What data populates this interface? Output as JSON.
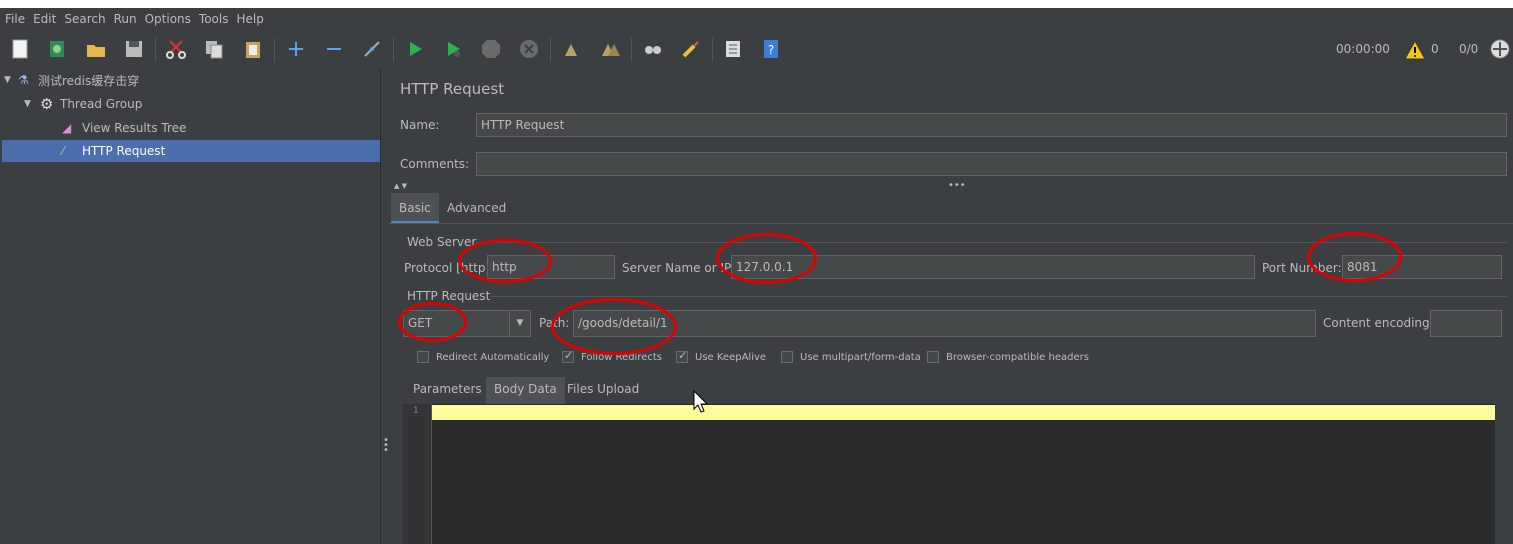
{
  "menu": [
    "File",
    "Edit",
    "Search",
    "Run",
    "Options",
    "Tools",
    "Help"
  ],
  "toolbar_icons": [
    "new-icon",
    "templates-icon",
    "open-icon",
    "save-icon",
    "cut-icon",
    "copy-icon",
    "paste-icon",
    "expand-icon",
    "collapse-icon",
    "toggle-icon",
    "start-icon",
    "start-no-pauses-icon",
    "stop-icon",
    "shutdown-icon",
    "clear-icon",
    "clear-all-icon",
    "search-icon",
    "reset-search-icon",
    "function-helper-icon",
    "help-icon"
  ],
  "status": {
    "timer": "00:00:00",
    "warnings": "0",
    "threads": "0/0"
  },
  "tree": {
    "plan": "测试redis缓存击穿",
    "thread_group": "Thread Group",
    "results_tree": "View Results Tree",
    "http_request": "HTTP Request"
  },
  "panel": {
    "title": "HTTP Request",
    "name_label": "Name:",
    "name_value": "HTTP Request",
    "comments_label": "Comments:",
    "comments_value": "",
    "tabs": [
      "Basic",
      "Advanced"
    ]
  },
  "web_server": {
    "section": "Web Server",
    "protocol_label": "Protocol [http]:",
    "protocol_value": "http",
    "server_label": "Server Name or IP:",
    "server_value": "127.0.0.1",
    "port_label": "Port Number:",
    "port_value": "8081"
  },
  "http_request": {
    "section": "HTTP Request",
    "method": "GET",
    "path_label": "Path:",
    "path_value": "/goods/detail/1",
    "encoding_label": "Content encoding:",
    "encoding_value": ""
  },
  "options": [
    {
      "label": "Redirect Automatically",
      "checked": false
    },
    {
      "label": "Follow Redirects",
      "checked": true
    },
    {
      "label": "Use KeepAlive",
      "checked": true
    },
    {
      "label": "Use multipart/form-data",
      "checked": false
    },
    {
      "label": "Browser-compatible headers",
      "checked": false
    }
  ],
  "subtabs": [
    "Parameters",
    "Body Data",
    "Files Upload"
  ],
  "editor": {
    "line_number": "1",
    "content": ""
  }
}
